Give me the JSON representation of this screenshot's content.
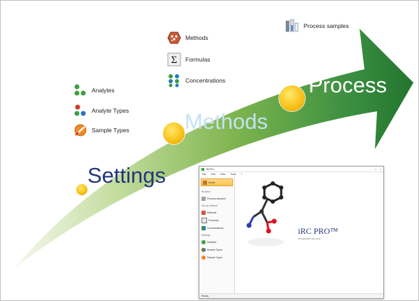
{
  "stages": {
    "settings": "Settings",
    "methods": "Methods",
    "process": "Process"
  },
  "items": {
    "methods": "Methods",
    "formulas": "Formulas",
    "concentrations": "Concentrations",
    "process_samples": "Process samples",
    "analytes": "Analytes",
    "analyte_types": "Analyte Types",
    "sample_types": "Sample Types"
  },
  "window": {
    "title": "iRCPro",
    "menu": [
      "File",
      "Edit",
      "View",
      "Tools",
      "?"
    ],
    "sidebar": {
      "home": "Home",
      "sec_process": "Process",
      "process_samples": "Process samples",
      "sec_setup": "Set up method",
      "methods": "Methods",
      "formulas": "Formulas",
      "concentrations": "Concentrations",
      "sec_settings": "Settings",
      "analytes": "Analytes",
      "analyte_types": "Analyte Types",
      "sample_types": "Sample Types"
    },
    "brand": "iRC PRO™",
    "tagline": "(for Research Use Only)",
    "status": "Ready"
  },
  "colors": {
    "arrow_light": "#e9f0dc",
    "arrow_dark": "#2e7d32",
    "dot": "#f7bf16",
    "settings_text": "#24357a",
    "methods_text": "#c5e3f3",
    "process_text": "#ffffff"
  }
}
